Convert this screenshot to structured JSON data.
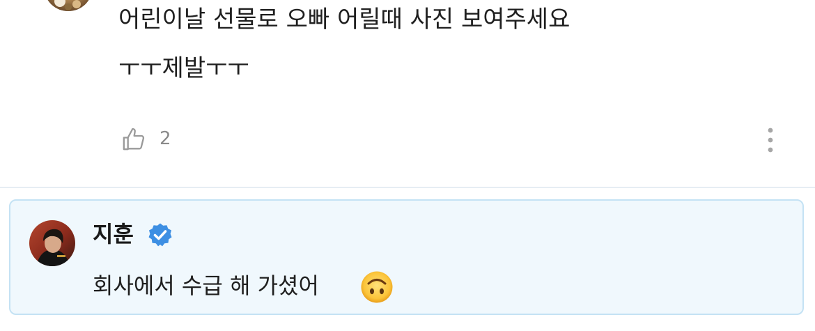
{
  "comment": {
    "line1": "어린이날 선물로 오빠 어릴때 사진 보여주세요",
    "line2": "ㅜㅜ제발ㅜㅜ",
    "like_count": "2",
    "icons": {
      "like": "thumbs-up-outline-icon",
      "more": "vertical-ellipsis-icon"
    }
  },
  "reply": {
    "author": "지훈",
    "text": "회사에서 수급 해 가셨어",
    "icons": {
      "verified": "verified-badge-icon",
      "emoji": "upside-down-face-emoji"
    }
  },
  "colors": {
    "reply_bg": "#f0f8fd",
    "reply_border": "#c4e2f4",
    "verified_blue": "#3d8fe3",
    "muted_gray": "#8a8a8a"
  }
}
